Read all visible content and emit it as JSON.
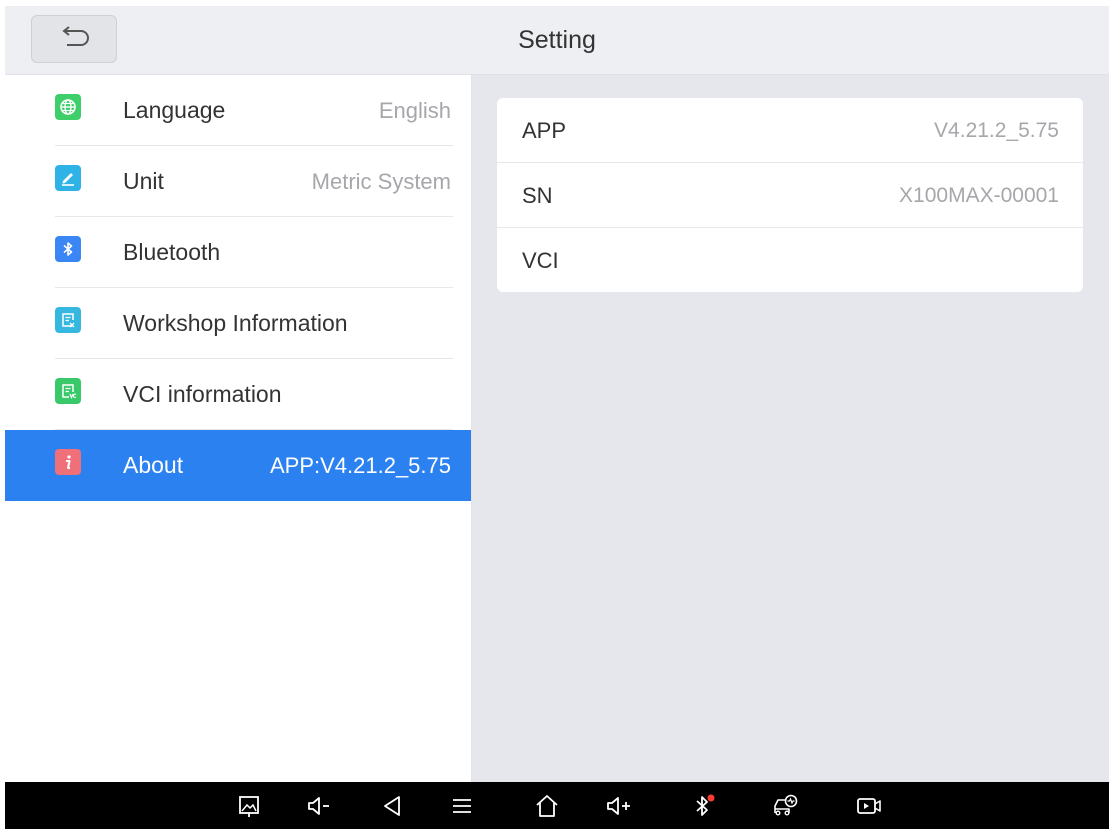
{
  "header": {
    "title": "Setting",
    "back_icon": "undo-arrow-icon"
  },
  "sidebar": {
    "items": [
      {
        "label": "Language",
        "value": "English",
        "icon": "globe-icon",
        "icon_color": "#3ecf6a"
      },
      {
        "label": "Unit",
        "value": "Metric System",
        "icon": "pencil-icon",
        "icon_color": "#2fb3e6"
      },
      {
        "label": "Bluetooth",
        "value": "",
        "icon": "bluetooth-icon",
        "icon_color": "#3a86f5"
      },
      {
        "label": "Workshop Information",
        "value": "",
        "icon": "document-icon",
        "icon_color": "#36b7e0"
      },
      {
        "label": "VCI information",
        "value": "",
        "icon": "vci-document-icon",
        "icon_color": "#39c96a"
      },
      {
        "label": "About",
        "value": "APP:V4.21.2_5.75",
        "icon": "info-icon",
        "icon_color": "#f0707a",
        "selected": true
      }
    ]
  },
  "about": {
    "rows": [
      {
        "key": "APP",
        "value": "V4.21.2_5.75"
      },
      {
        "key": "SN",
        "value": "X100MAX-00001"
      },
      {
        "key": "VCI",
        "value": ""
      }
    ]
  },
  "navbar": {
    "icons": [
      "screenshot-icon",
      "volume-down-icon",
      "back-triangle-icon",
      "menu-icon",
      "home-icon",
      "volume-up-icon",
      "bluetooth-status-icon",
      "car-diagnostic-icon",
      "screen-record-icon"
    ]
  },
  "colors": {
    "accent": "#2b81f0",
    "background": "#e6e7ec",
    "text_primary": "#333333",
    "text_secondary": "#a6a7ab",
    "bluetooth_alert": "#ff3b30"
  }
}
